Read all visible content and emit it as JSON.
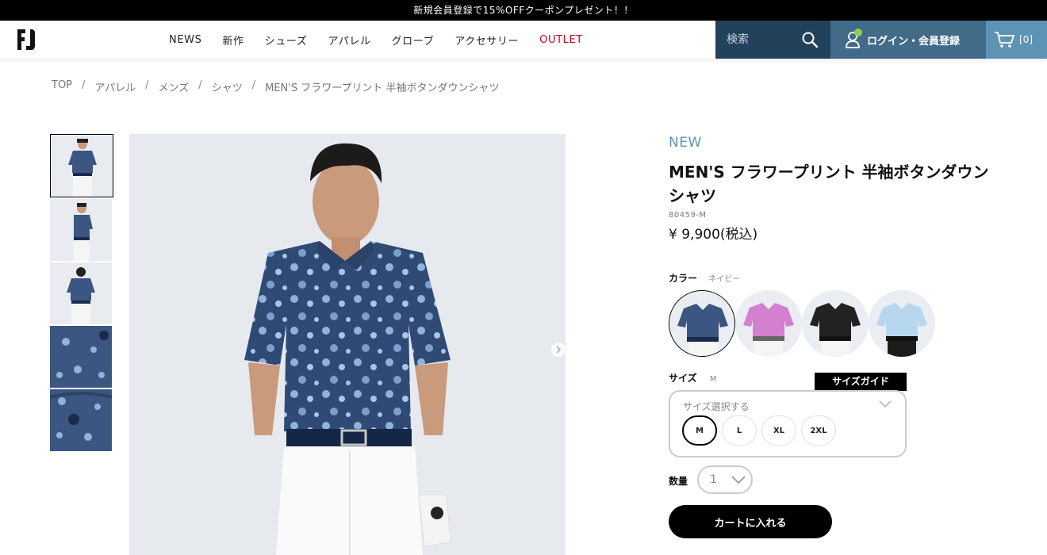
{
  "promo": {
    "text": "新規会員登録で15%OFFクーポンプレゼント！！"
  },
  "header": {
    "nav": [
      "NEWS",
      "新作",
      "シューズ",
      "アパレル",
      "グローブ",
      "アクセサリー",
      "OUTLET"
    ],
    "search_placeholder": "検索",
    "login_label": "ログイン・会員登録",
    "cart_count": "[0]"
  },
  "breadcrumb": [
    "TOP",
    "アパレル",
    "メンズ",
    "シャツ",
    "MEN'S フラワープリント 半袖ボタンダウンシャツ"
  ],
  "product": {
    "badge": "NEW",
    "title": "MEN'S フラワープリント 半袖ボタンダウンシャツ",
    "sku": "80459-M",
    "price": "¥ 9,900(税込)",
    "color_label": "カラー",
    "color_selected": "ネイビー",
    "size_label": "サイズ",
    "size_selected": "M",
    "size_guide": "サイズガイド",
    "size_placeholder": "サイズ選択する",
    "sizes": [
      "M",
      "L",
      "XL",
      "2XL"
    ],
    "qty_label": "数量",
    "qty_value": "1",
    "add_to_cart": "カートに入れる"
  },
  "swatch_colors": [
    "#3b5680",
    "#d57fcf",
    "#222222",
    "#b7d7ee"
  ],
  "accent": {
    "search_bg": "#22425c",
    "login_bg": "#426b8a",
    "cart_bg": "#5e93b3",
    "outlet": "#d0021b"
  }
}
